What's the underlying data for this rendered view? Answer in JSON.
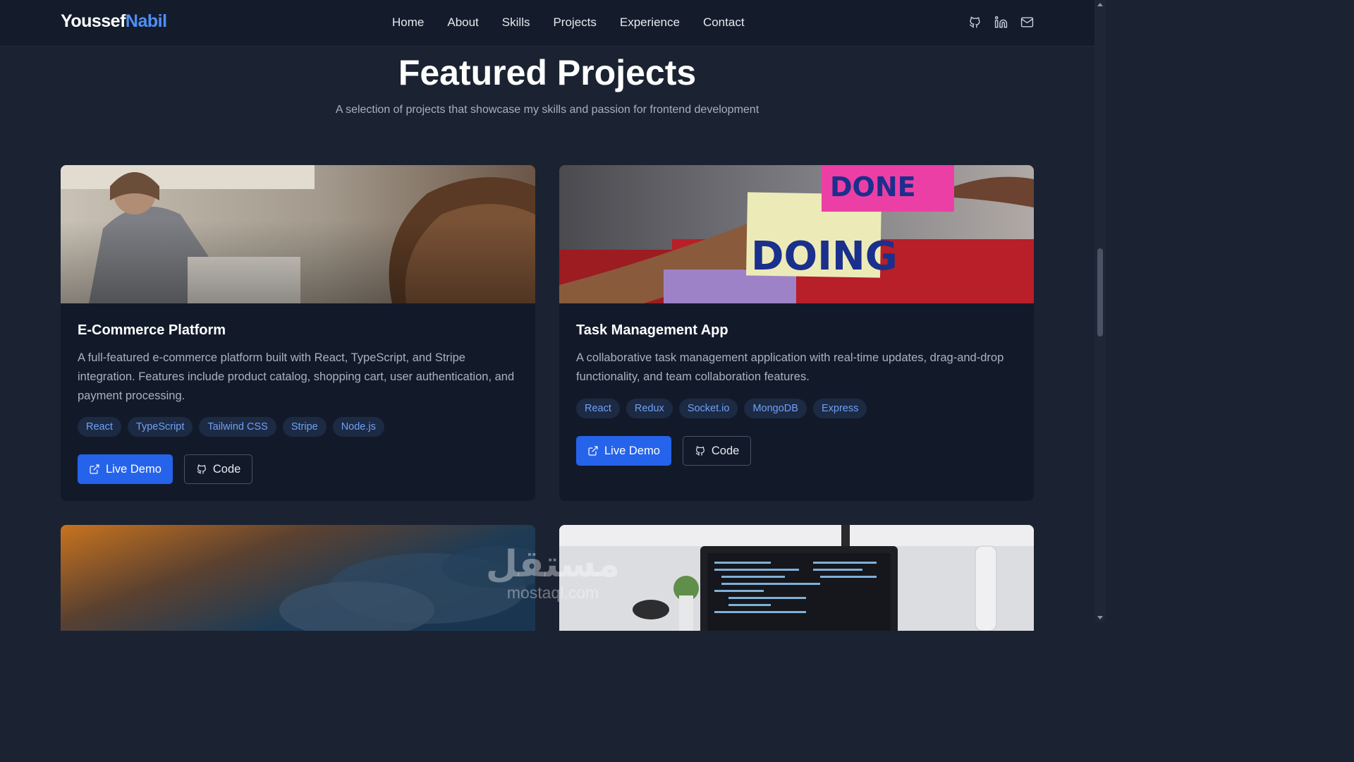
{
  "brand": {
    "first": "Youssef",
    "last": "Nabil",
    "accent": "#4f8ff7"
  },
  "nav": {
    "items": [
      "Home",
      "About",
      "Skills",
      "Projects",
      "Experience",
      "Contact"
    ]
  },
  "social": {
    "icons": [
      "github-icon",
      "linkedin-icon",
      "mail-icon"
    ]
  },
  "section": {
    "title": "Featured Projects",
    "subtitle": "A selection of projects that showcase my skills and passion for frontend development"
  },
  "projects": [
    {
      "title": "E-Commerce Platform",
      "description": "A full-featured e-commerce platform built with React, TypeScript, and Stripe integration. Features include product catalog, shopping cart, user authentication, and payment processing.",
      "tags": [
        "React",
        "TypeScript",
        "Tailwind CSS",
        "Stripe",
        "Node.js"
      ],
      "live_label": "Live Demo",
      "code_label": "Code"
    },
    {
      "title": "Task Management App",
      "description": "A collaborative task management application with real-time updates, drag-and-drop functionality, and team collaboration features.",
      "tags": [
        "React",
        "Redux",
        "Socket.io",
        "MongoDB",
        "Express"
      ],
      "live_label": "Live Demo",
      "code_label": "Code",
      "image_notes": [
        "DONE",
        "DOING"
      ]
    }
  ],
  "watermark": {
    "arabic": "مستقل",
    "latin": "mostaql.com"
  },
  "colors": {
    "background": "#1b2332",
    "card": "#121a2a",
    "primary_button": "#2563eb",
    "tag_text": "#6ea1f6"
  }
}
